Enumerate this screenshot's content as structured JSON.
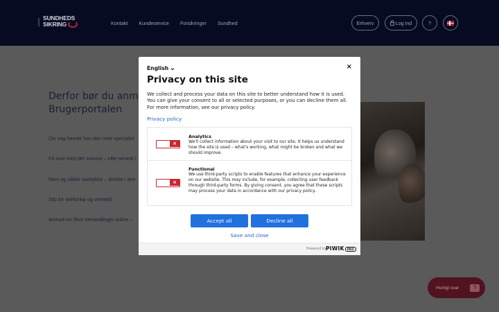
{
  "header": {
    "logo": {
      "small": "DANSKE",
      "line1": "SUNDHEDS",
      "line2": "SIKRING"
    },
    "nav": [
      "Kontakt",
      "Kundeservice",
      "Forsikringer",
      "Sundhed"
    ],
    "erhverv_label": "Erhverv",
    "login_label": "Log ind",
    "help_label": "?"
  },
  "background": {
    "title_line1": "Derfor bør du anme",
    "title_line2": "Brugerportalen",
    "items": [
      "Din sag havner hos den rette specialist",
      "Få svar med det samme – eller senest i",
      "Nem og sikker samtykke – direkte i ann",
      "Slip for telefonkø og ventetid",
      "Anmod om flere behandlinger online –"
    ],
    "chat_label": "Hurtigt svar",
    "chat_icon": "?"
  },
  "modal": {
    "language": "English",
    "close": "×",
    "title": "Privacy on this site",
    "description": "We collect and process your data on this site to better understand how it is used. You can give your consent to all or selected purposes, or you can decline them all. For more information, see our privacy policy.",
    "privacy_link": "Privacy policy",
    "purposes": [
      {
        "name": "Analytics",
        "description": "We'll collect information about your visit to our site. It helps us understand how the site is used – what's working, what might be broken and what we should improve.",
        "enabled": false
      },
      {
        "name": "Functional",
        "description": "We use third-party scripts to enable features that enhance your experience on our website. This may include, for example, collecting user feedback through third-party forms. By giving consent, you agree that these scripts may process your data in accordance with our privacy policy.",
        "enabled": false
      }
    ],
    "toggle_off_symbol": "×",
    "accept_label": "Accept all",
    "decline_label": "Decline all",
    "save_label": "Save and close",
    "powered_by": "Powered by",
    "brand": "PIWIK",
    "brand_tag": "PRO"
  },
  "colors": {
    "header_bg": "#070b21",
    "overlay": "#5a5a5a",
    "primary_button": "#2070de",
    "link": "#1f64c8",
    "toggle_off": "#c8272f"
  }
}
